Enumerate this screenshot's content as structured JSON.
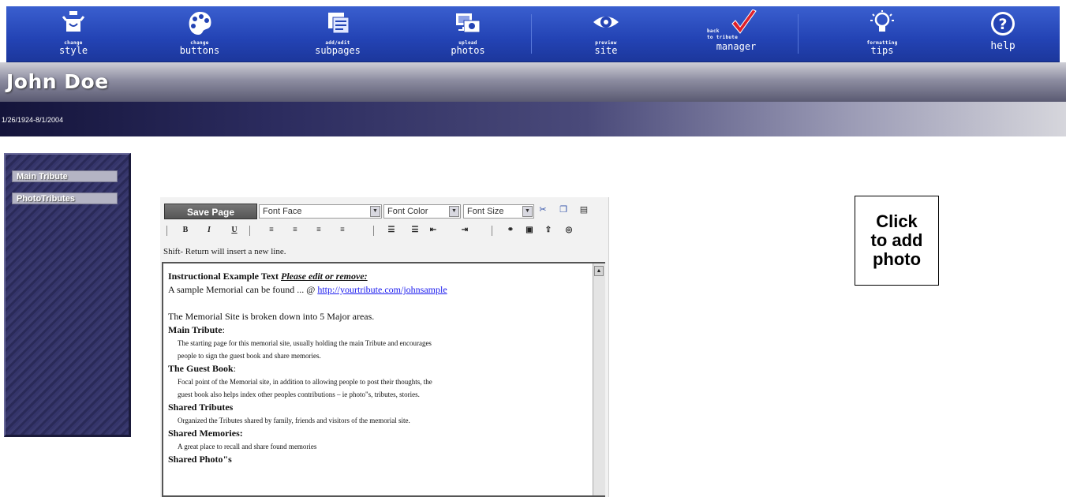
{
  "toolbar": {
    "style": {
      "top": "change",
      "main": "style"
    },
    "buttons": {
      "top": "change",
      "main": "buttons"
    },
    "subpages": {
      "top": "add/edit",
      "main": "subpages"
    },
    "photos": {
      "top": "upload",
      "main": "photos"
    },
    "preview": {
      "top": "preview",
      "main": "site"
    },
    "manager": {
      "top1": "back",
      "top2": "to tribute",
      "main": "manager"
    },
    "tips": {
      "top": "formatting",
      "main": "tips"
    },
    "help": {
      "main": "help"
    }
  },
  "header": {
    "name": "John Doe",
    "dates": "1/26/1924-8/1/2004"
  },
  "sidebar": {
    "items": [
      {
        "label": "Main Tribute"
      },
      {
        "label": "PhotoTributes"
      }
    ]
  },
  "editor": {
    "save_label": "Save Page",
    "font_face": "Font Face",
    "font_color": "Font Color",
    "font_size": "Font Size",
    "hint": "Shift- Return  will insert a new line.",
    "content": {
      "intro_heading": "Instructional Example Text",
      "intro_edit": "Please edit or remove:",
      "sample_text": "A sample Memorial can be found ... @",
      "sample_link": "http://yourtribute.com/johnsample",
      "overview": "The Memorial Site is broken down into 5 Major areas.",
      "main_heading": "Main Tribute",
      "main_colon": ":",
      "main_desc_1": "The starting page for this memorial site, usually holding the main Tribute and encourages",
      "main_desc_2": "people to sign the guest book and share memories.",
      "guest_heading": "The Guest Book",
      "guest_colon": ":",
      "guest_desc_1": "Focal point of the Memorial site, in addition to allowing people to post their thoughts, the",
      "guest_desc_2": "guest book also helps index other peoples contributions – ie photo\"s, tributes, stories.",
      "tributes_heading": "Shared Tributes",
      "tributes_desc": "Organized the Tributes shared by family, friends and visitors of the memorial site.",
      "memories_heading": "Shared Memories:",
      "memories_desc": "A great place to recall and share found memories",
      "photos_heading": "Shared Photo\"s"
    }
  },
  "photo_box": {
    "line1": "Click",
    "line2": "to add",
    "line3": "photo"
  },
  "colors": {
    "toolbar": "#2343b4",
    "check": "#e0202a",
    "sidebar": "#34346a"
  }
}
